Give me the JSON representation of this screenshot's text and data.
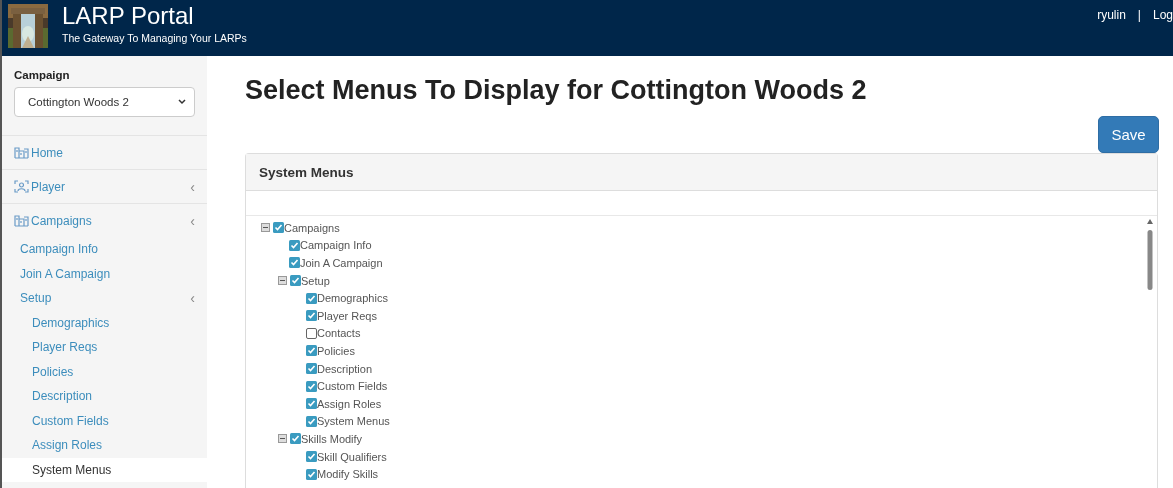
{
  "header": {
    "title": "LARP Portal",
    "subtitle": "The Gateway To Managing Your LARPs",
    "user": "ryulin",
    "separator": "|",
    "logout": "Log"
  },
  "sidebar": {
    "campaign_label": "Campaign",
    "campaign_select": {
      "value": "Cottington Woods 2"
    },
    "items": [
      {
        "label": "Home",
        "kind": "top",
        "selected": false
      },
      {
        "label": "Player",
        "kind": "top",
        "selected": false,
        "chevron": "‹"
      },
      {
        "label": "Campaigns",
        "kind": "top",
        "selected": false,
        "chevron": "‹",
        "children": [
          {
            "label": "Campaign Info",
            "selected": false
          },
          {
            "label": "Join A Campaign",
            "selected": false
          },
          {
            "label": "Setup",
            "selected": false,
            "chevron": "‹",
            "children": [
              {
                "label": "Demographics",
                "selected": false
              },
              {
                "label": "Player Reqs",
                "selected": false
              },
              {
                "label": "Policies",
                "selected": false
              },
              {
                "label": "Description",
                "selected": false
              },
              {
                "label": "Custom Fields",
                "selected": false
              },
              {
                "label": "Assign Roles",
                "selected": false
              },
              {
                "label": "System Menus",
                "selected": true
              }
            ]
          }
        ]
      }
    ]
  },
  "page_title": "Select Menus To Display for Cottington Woods 2",
  "save_button": "Save",
  "panel": {
    "heading": "System Menus",
    "tree": [
      {
        "label": "Campaigns",
        "checked": true,
        "expanded": true,
        "children": [
          {
            "label": "Campaign Info",
            "checked": true
          },
          {
            "label": "Join A Campaign",
            "checked": true
          },
          {
            "label": "Setup",
            "checked": true,
            "expanded": true,
            "children": [
              {
                "label": "Demographics",
                "checked": true
              },
              {
                "label": "Player Reqs",
                "checked": true
              },
              {
                "label": "Contacts",
                "checked": false
              },
              {
                "label": "Policies",
                "checked": true
              },
              {
                "label": "Description",
                "checked": true
              },
              {
                "label": "Custom Fields",
                "checked": true
              },
              {
                "label": "Assign Roles",
                "checked": true
              },
              {
                "label": "System Menus",
                "checked": true
              }
            ]
          },
          {
            "label": "Skills Modify",
            "checked": true,
            "expanded": true,
            "children": [
              {
                "label": "Skill Qualifiers",
                "checked": true
              },
              {
                "label": "Modify Skills",
                "checked": true
              }
            ]
          }
        ]
      }
    ]
  }
}
